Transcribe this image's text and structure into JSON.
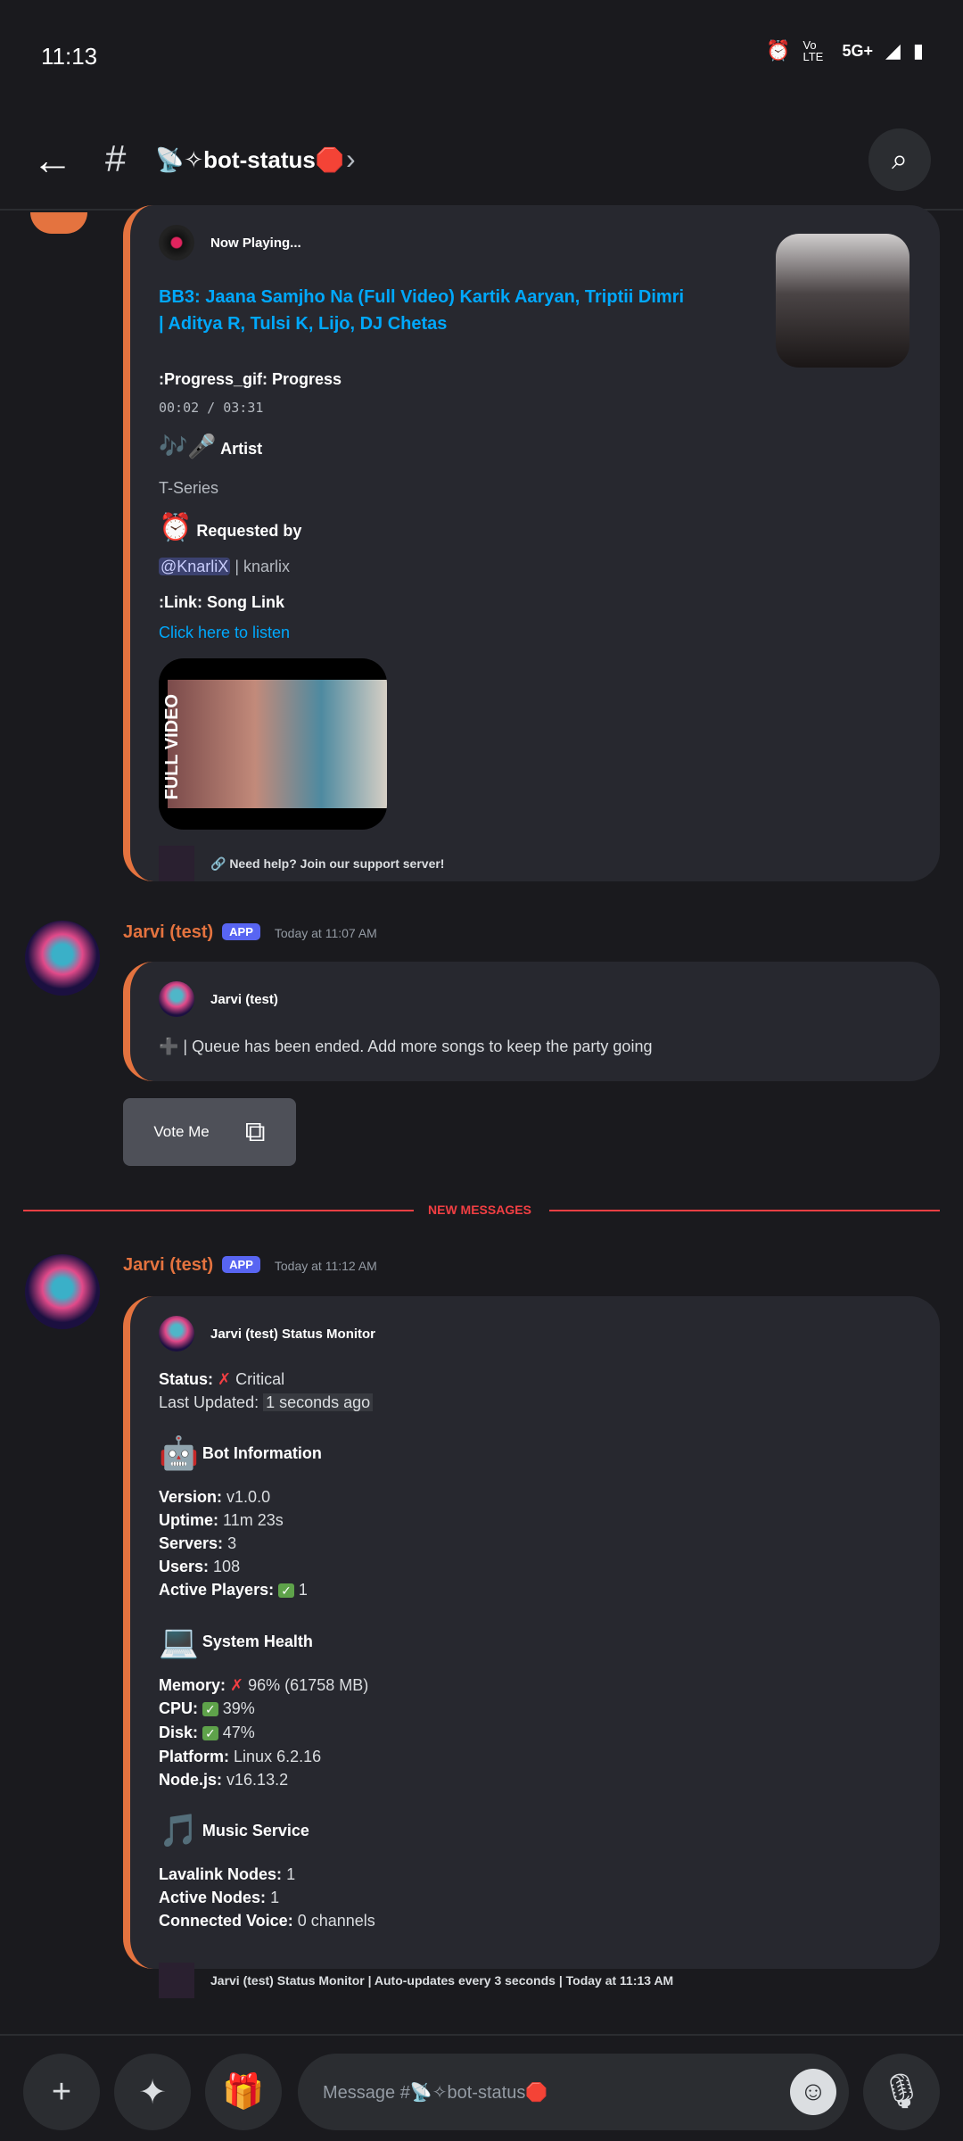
{
  "status_bar": {
    "time": "11:13",
    "network": "5G+",
    "volte": "Vo LTE"
  },
  "header": {
    "channel": "📡✧bot-status🛑"
  },
  "now_playing": {
    "author": "Now Playing...",
    "title": "BB3: Jaana Samjho Na (Full Video) Kartik Aaryan, Triptii Dimri | Aditya R, Tulsi K, Lijo, DJ Chetas",
    "progress_label": ":Progress_gif: Progress",
    "progress_time": "00:02 / 03:31",
    "artist_emoji": "🎶🎤",
    "artist_label": "Artist",
    "artist": "T-Series",
    "requested_emoji": "⏰",
    "requested_label": "Requested by",
    "requester_mention": "@KnarliX",
    "requester_user": "| knarlix",
    "link_label": ":Link: Song Link",
    "link_text": "Click here to listen",
    "video_label": "FULL VIDEO",
    "footer": "🔗 Need help? Join our support server!"
  },
  "message1": {
    "username": "Jarvi (test)",
    "badge": "APP",
    "timestamp": "Today at 11:07 AM",
    "embed_author": "Jarvi (test)",
    "embed_text": "➕ | Queue has been ended. Add more songs to keep the party going",
    "button": "Vote Me"
  },
  "divider": {
    "label": "NEW MESSAGES"
  },
  "message2": {
    "username": "Jarvi (test)",
    "badge": "APP",
    "timestamp": "Today at 11:12 AM",
    "embed_author": "Jarvi (test) Status Monitor",
    "status_label": "Status:",
    "status_value": "Critical",
    "updated_label": "Last Updated:",
    "updated_value": "1 seconds ago",
    "sections": [
      {
        "emoji": "🤖",
        "title": "Bot Information",
        "fields": [
          {
            "label": "Version:",
            "value": "v1.0.0"
          },
          {
            "label": "Uptime:",
            "value": "11m 23s"
          },
          {
            "label": "Servers:",
            "value": "3"
          },
          {
            "label": "Users:",
            "value": "108"
          },
          {
            "label": "Active Players:",
            "icon": "✓",
            "value": "1"
          }
        ]
      },
      {
        "emoji": "💻",
        "title": "System Health",
        "fields": [
          {
            "label": "Memory:",
            "icon": "✗",
            "value": "96% (61758 MB)"
          },
          {
            "label": "CPU:",
            "icon": "✓",
            "value": "39%"
          },
          {
            "label": "Disk:",
            "icon": "✓",
            "value": "47%"
          },
          {
            "label": "Platform:",
            "value": "Linux 6.2.16"
          },
          {
            "label": "Node.js:",
            "value": "v16.13.2"
          }
        ]
      },
      {
        "emoji": "🎵",
        "title": "Music Service",
        "fields": [
          {
            "label": "Lavalink Nodes:",
            "value": "1"
          },
          {
            "label": "Active Nodes:",
            "value": "1"
          },
          {
            "label": "Connected Voice:",
            "value": "0 channels"
          }
        ]
      }
    ],
    "footer": "Jarvi (test) Status Monitor | Auto-updates every 3 seconds | Today at 11:13 AM"
  },
  "composer": {
    "placeholder": "Message #📡✧bot-status🛑"
  },
  "colors": {
    "accent": "#e4733f",
    "link": "#00a8fc",
    "badge": "#5865f2",
    "new_messages": "#f23f43"
  }
}
